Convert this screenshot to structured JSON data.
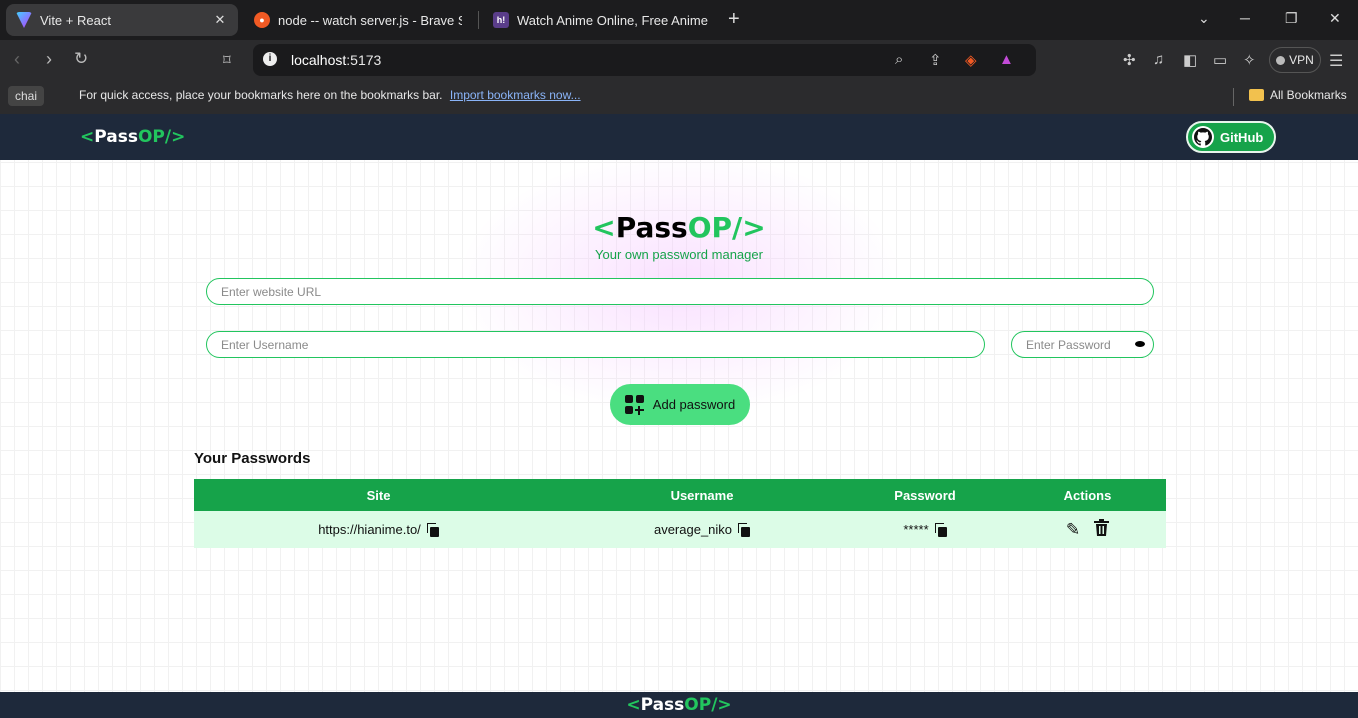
{
  "browser": {
    "tabs": [
      {
        "title": "Vite + React",
        "active": true
      },
      {
        "title": "node -- watch server.js - Brave Search",
        "active": false
      },
      {
        "title": "Watch Anime Online, Free Anime Streaming",
        "active": false
      }
    ],
    "address": {
      "host": "localhost",
      "port": ":5173"
    },
    "vpn_label": "VPN",
    "bookmarks": {
      "profile_chip": "chai",
      "message": "For quick access, place your bookmarks here on the bookmarks bar.",
      "import_link": "Import bookmarks now...",
      "all_bookmarks": "All Bookmarks"
    }
  },
  "navbar": {
    "logo": {
      "open": "<",
      "name": "Pass",
      "accent": "OP/",
      "close": ">"
    },
    "github_label": "GitHub"
  },
  "hero": {
    "logo": {
      "open": "<",
      "name": "Pass",
      "accent": "OP/",
      "close": ">"
    },
    "subtitle": "Your own password manager"
  },
  "form": {
    "site_placeholder": "Enter website URL",
    "username_placeholder": "Enter Username",
    "password_placeholder": "Enter Password",
    "add_button_label": "Add password"
  },
  "passwords": {
    "title": "Your Passwords",
    "columns": [
      "Site",
      "Username",
      "Password",
      "Actions"
    ],
    "rows": [
      {
        "site": "https://hianime.to/",
        "username": "average_niko",
        "password": "*****"
      }
    ]
  },
  "footer": {
    "logo": {
      "open": "<",
      "name": "Pass",
      "accent": "OP/",
      "close": ">"
    }
  },
  "colors": {
    "accent": "#22c55e",
    "nav_bg": "#1e293b",
    "table_header": "#16a34a",
    "row_bg": "#dcfce7"
  }
}
